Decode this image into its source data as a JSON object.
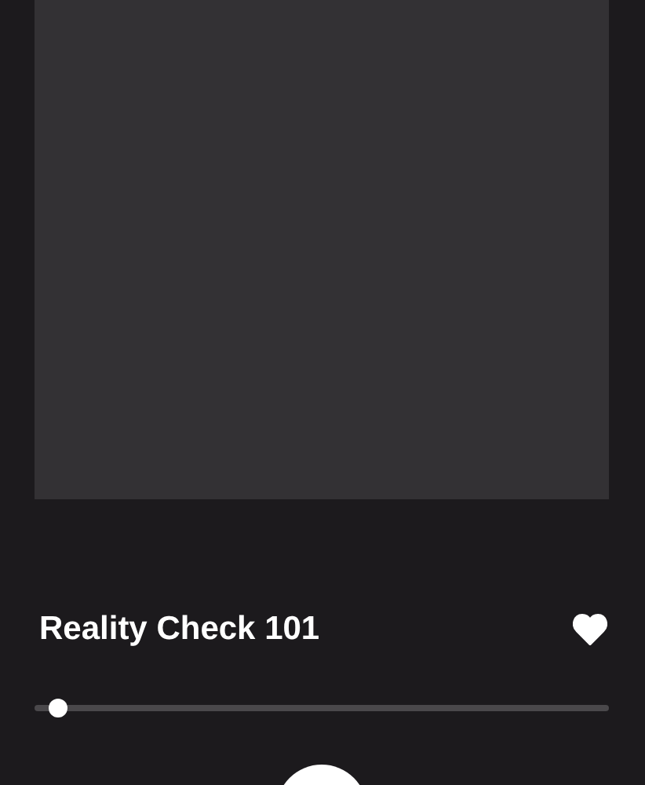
{
  "track": {
    "title": "Reality Check 101",
    "favorite": true
  },
  "progress": {
    "level": 0.02
  }
}
